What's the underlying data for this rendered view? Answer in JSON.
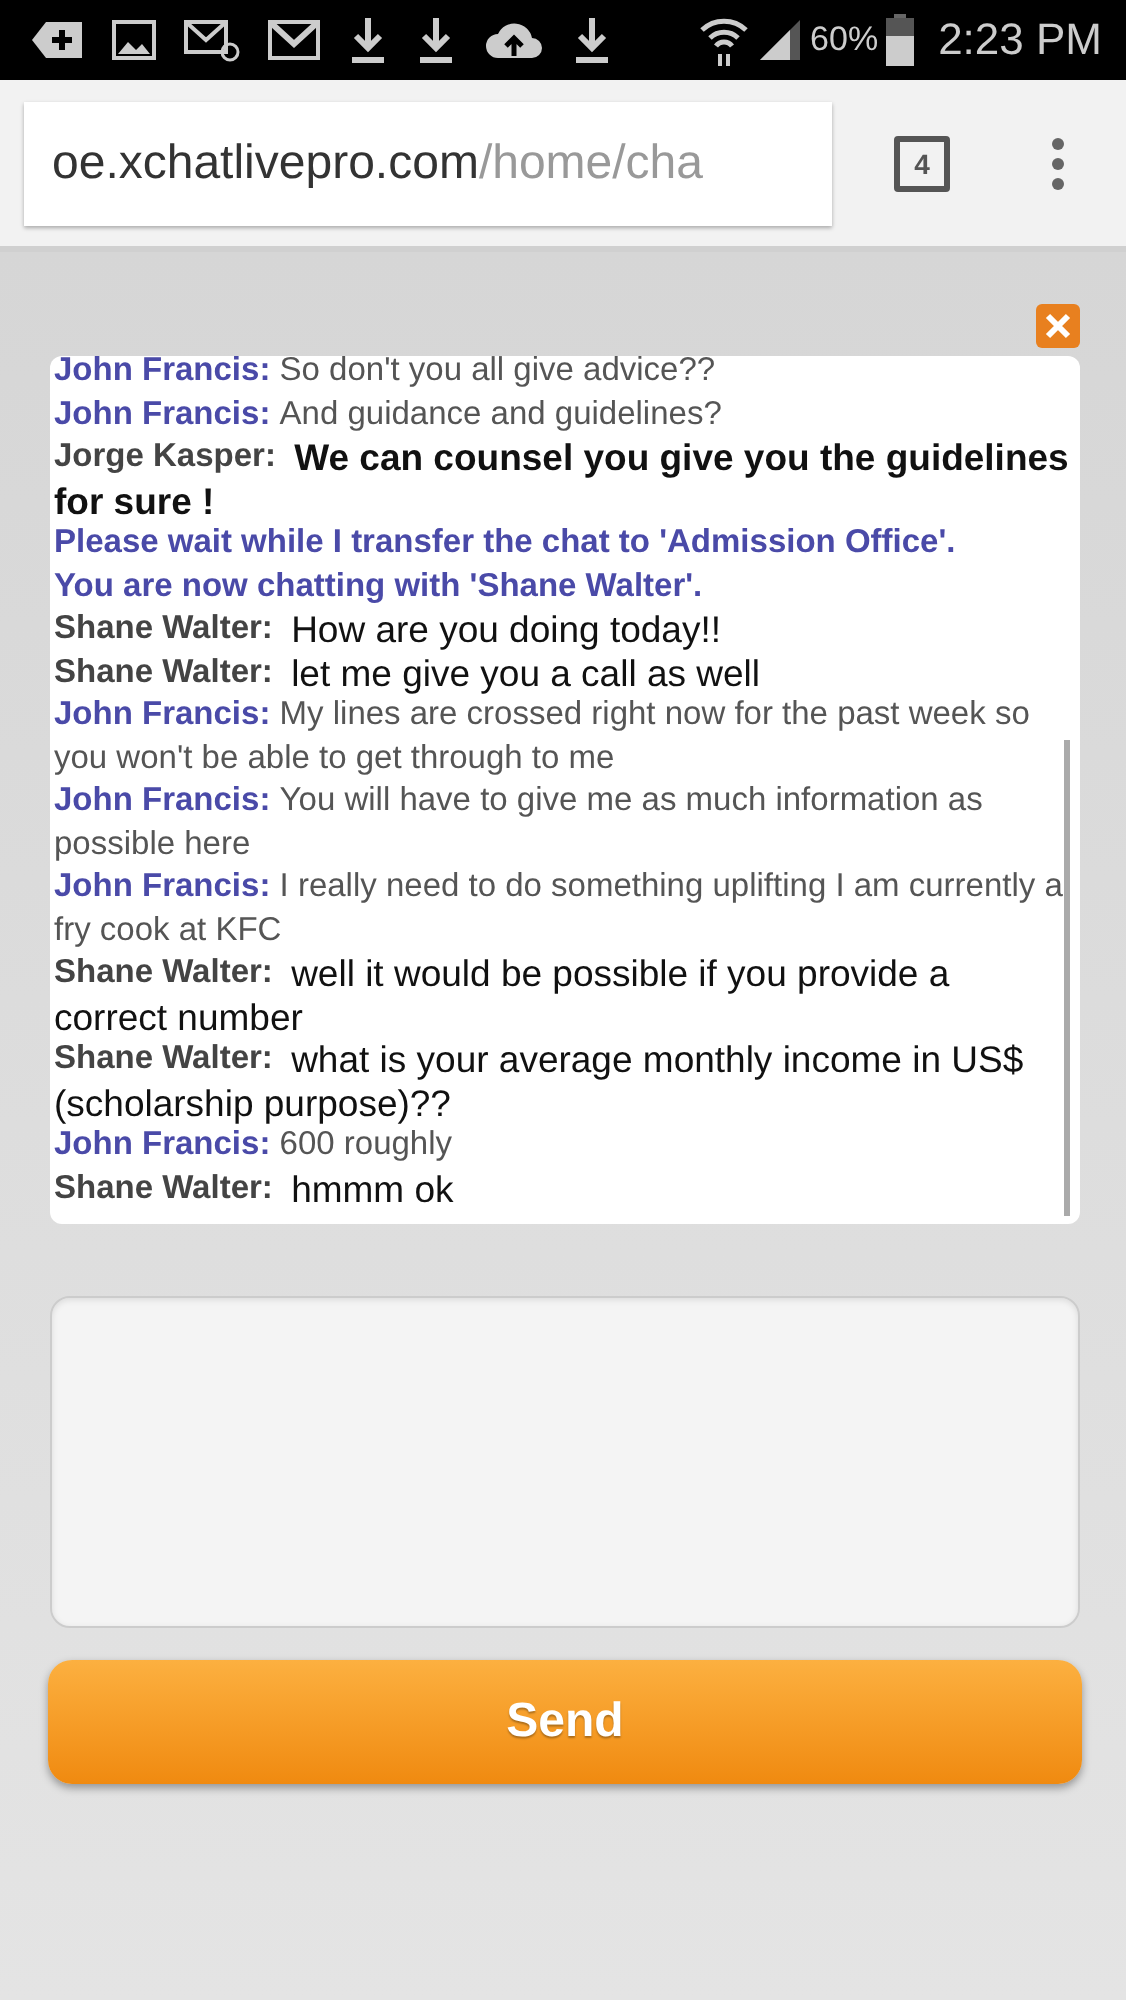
{
  "status_bar": {
    "battery": "60%",
    "time": "2:23 PM"
  },
  "browser": {
    "url_host": "oe.xchatlivepro.com",
    "url_path": "/home/cha",
    "tab_count": "4"
  },
  "chat": {
    "messages": [
      {
        "kind": "visitor",
        "sender": "John Francis:",
        "text": "So don't you all give advice??"
      },
      {
        "kind": "visitor",
        "sender": "John Francis:",
        "text": "And guidance and guidelines?"
      },
      {
        "kind": "agent_bold",
        "sender": "Jorge Kasper:",
        "text": "We can counsel you give you the guidelines for sure !"
      },
      {
        "kind": "system",
        "text": "Please wait while I transfer the chat to 'Admission Office'."
      },
      {
        "kind": "system",
        "text": "You are now chatting with 'Shane Walter'."
      },
      {
        "kind": "agent",
        "sender": "Shane Walter:",
        "text": "How are you doing today!!"
      },
      {
        "kind": "agent",
        "sender": "Shane Walter:",
        "text": "let me give you a call as well"
      },
      {
        "kind": "visitor",
        "sender": "John Francis:",
        "text": "My lines are crossed right now for the past week so you won't be able to get through to me"
      },
      {
        "kind": "visitor",
        "sender": "John Francis:",
        "text": "You will have to give me as much information as possible here"
      },
      {
        "kind": "visitor",
        "sender": "John Francis:",
        "text": "I really need to do something uplifting I am currently a fry cook at KFC"
      },
      {
        "kind": "agent",
        "sender": "Shane Walter:",
        "text": "well it would be possible if you provide a correct number"
      },
      {
        "kind": "agent",
        "sender": "Shane Walter:",
        "text": "what is your average monthly income in US$ (scholarship purpose)??"
      },
      {
        "kind": "visitor",
        "sender": "John Francis:",
        "text": "600 roughly"
      },
      {
        "kind": "agent",
        "sender": "Shane Walter:",
        "text": "hmmm ok"
      }
    ]
  },
  "send_button": "Send"
}
